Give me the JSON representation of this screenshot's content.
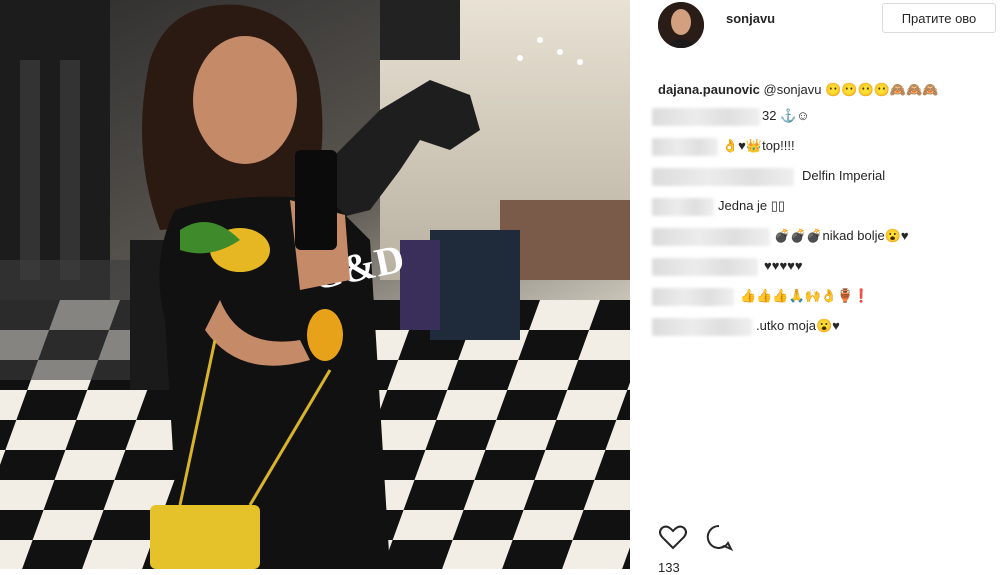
{
  "post": {
    "username": "sonjavu",
    "follow_label": "Пратите ово"
  },
  "caption": {
    "user": "dajana.paunovic",
    "mention": "@sonjavu",
    "emoji": "😶😶😶😶🙈🙈🙈"
  },
  "comments": [
    {
      "text": "32 ⚓☺"
    },
    {
      "text": "👌♥👑top!!!!"
    },
    {
      "text": "Delfin Imperial"
    },
    {
      "text": "Jedna je ▯▯"
    },
    {
      "text": "💣💣💣nikad bolje😮♥"
    },
    {
      "text": "♥♥♥♥♥"
    },
    {
      "text": "👍👍👍🙏🙌👌🏺❗"
    },
    {
      "text": ".utko moja😮♥"
    }
  ],
  "actions": {
    "likes_partial": "133"
  }
}
